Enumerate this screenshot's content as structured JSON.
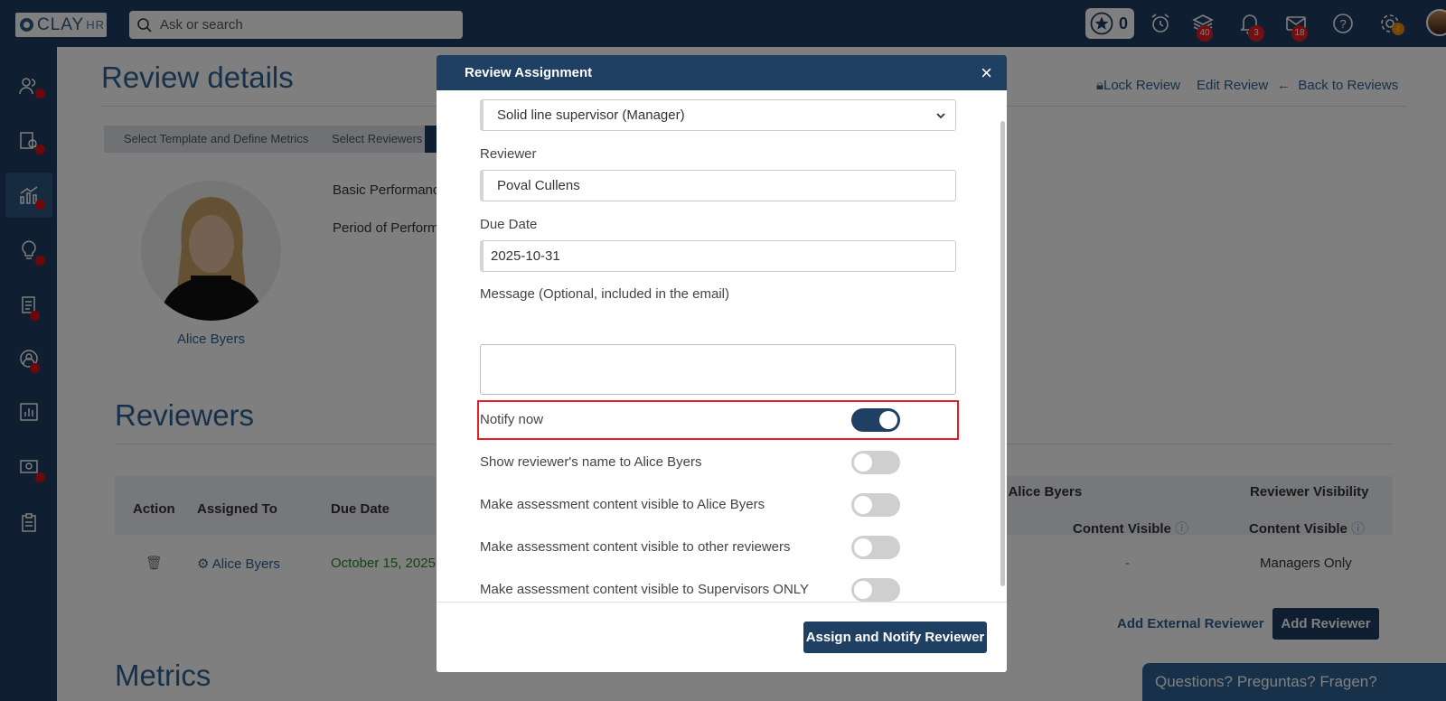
{
  "topbar": {
    "logo_text": "CLAY",
    "logo_suffix": "HR",
    "search_placeholder": "Ask or search",
    "star_count": "0",
    "badges": {
      "layers": "40",
      "bell": "3",
      "mail": "18",
      "settings": "!"
    }
  },
  "page": {
    "title": "Review details",
    "links": {
      "lock": "Lock Review",
      "edit": "Edit Review",
      "back": "Back to Reviews"
    },
    "steps": [
      "Select Template and Define Metrics",
      "Select Reviewers"
    ],
    "employee_name": "Alice Byers",
    "info_labels": [
      "Basic Performanc",
      "Period of Perform"
    ],
    "reviewers_title": "Reviewers",
    "metrics_title": "Metrics"
  },
  "table": {
    "headers": {
      "action": "Action",
      "assigned_to": "Assigned To",
      "due_date": "Due Date",
      "for_employee": "r Alice Byers",
      "reviewer_visibility": "Reviewer Visibility",
      "content_visible_1": "Content Visible",
      "content_visible_2": "Content Visible"
    },
    "row": {
      "assigned_to": "Alice Byers",
      "due_date": "October 15, 2025",
      "dash": "-",
      "visibility": "Managers Only"
    }
  },
  "actions": {
    "add_external": "Add External Reviewer",
    "add_reviewer": "Add Reviewer"
  },
  "chat": "Questions? Preguntas? Fragen?",
  "modal": {
    "title": "Review Assignment",
    "close": "×",
    "relationship_value": "Solid line supervisor (Manager)",
    "reviewer_label": "Reviewer",
    "reviewer_value": "Poval Cullens",
    "due_label": "Due Date",
    "due_value": "2025-10-31",
    "message_label": "Message (Optional, included in the email)",
    "message_value": "",
    "toggles": [
      {
        "label": "Notify now",
        "on": true
      },
      {
        "label": "Show reviewer's name to Alice Byers",
        "on": false
      },
      {
        "label": "Make assessment content visible to Alice Byers",
        "on": false
      },
      {
        "label": "Make assessment content visible to other reviewers",
        "on": false
      },
      {
        "label": "Make assessment content visible to Supervisors ONLY",
        "on": false
      }
    ],
    "submit": "Assign and Notify Reviewer"
  },
  "colors": {
    "brand": "#1f3f63",
    "link": "#2e6294",
    "alert": "#e31e24",
    "due": "#1f8a1f"
  }
}
